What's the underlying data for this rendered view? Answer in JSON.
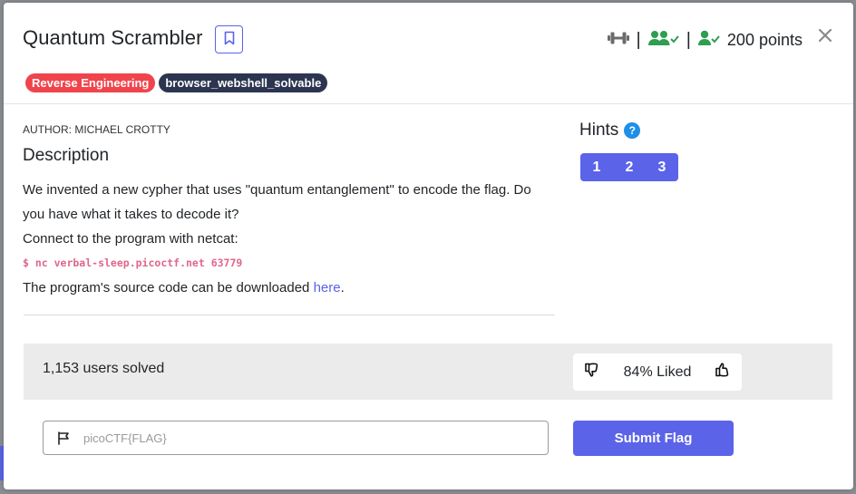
{
  "challenge": {
    "title": "Quantum Scrambler",
    "points": "200 points",
    "separator": "|",
    "tags": [
      "Reverse Engineering",
      "browser_webshell_solvable"
    ],
    "author": "AUTHOR: MICHAEL CROTTY",
    "description_heading": "Description",
    "description_line1": "We invented a new cypher that uses \"quantum entanglement\" to encode the flag. Do you have what it takes to decode it?",
    "description_line2": "Connect to the program with netcat:",
    "command": "$ nc verbal-sleep.picoctf.net 63779",
    "source_prefix": "The program's source code can be downloaded ",
    "source_link": "here",
    "source_suffix": "."
  },
  "hints": {
    "heading": "Hints",
    "help_glyph": "?",
    "buttons": [
      "1",
      "2",
      "3"
    ]
  },
  "stats": {
    "solved": "1,153 users solved",
    "liked": "84% Liked"
  },
  "flag_form": {
    "placeholder": "picoCTF{FLAG}",
    "value": "",
    "submit_label": "Submit Flag"
  },
  "colors": {
    "accent": "#5b63e9",
    "tag_red": "#f0444c",
    "tag_dark": "#2c3550",
    "success_green": "#2e9e4f",
    "code_pink": "#e0668a",
    "help_blue": "#1e8fe8"
  },
  "icons": {
    "bookmark": "bookmark-icon",
    "difficulty": "dumbbell-icon",
    "users_solved": "users-check-icon",
    "user_solved": "user-check-icon",
    "close": "close-icon",
    "dislike": "thumbs-down-icon",
    "like": "thumbs-up-icon",
    "flag": "flag-icon"
  }
}
